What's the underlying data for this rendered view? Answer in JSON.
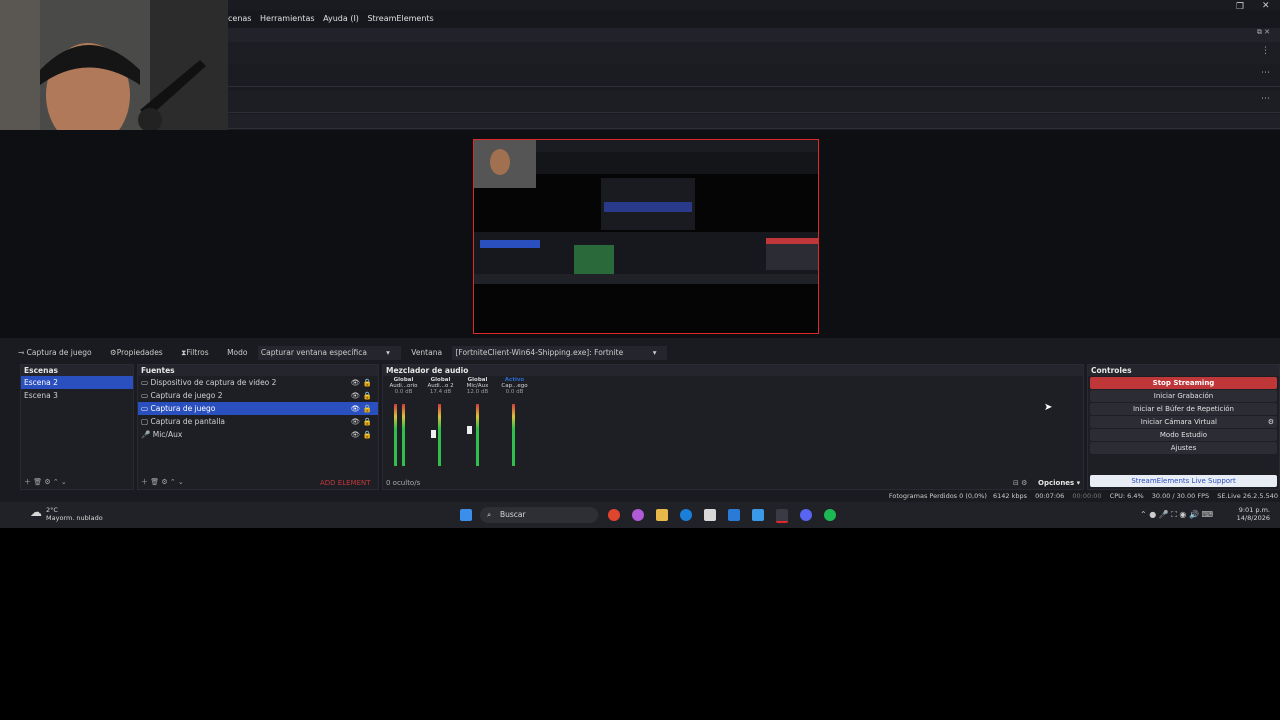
{
  "menubar": {
    "items": [
      "cenas",
      "Herramientas",
      "Ayuda (I)",
      "StreamElements"
    ]
  },
  "toolbar": {
    "source": "Captura de juego",
    "properties": "Propiedades",
    "filters": "Filtros",
    "mode_label": "Modo",
    "mode_value": "Capturar ventana específica",
    "window_label": "Ventana",
    "window_value": "[FortniteClient-Win64-Shipping.exe]: Fortnite"
  },
  "scenes": {
    "title": "Escenas",
    "items": [
      "Escena 2",
      "Escena 3"
    ],
    "selected": 0
  },
  "sources": {
    "title": "Fuentes",
    "items": [
      "Dispositivo de captura de video 2",
      "Captura de juego 2",
      "Captura de juego",
      "Captura de pantalla",
      "Mic/Aux"
    ],
    "selected": 2,
    "add_element": "ADD ELEMENT"
  },
  "mixer": {
    "title": "Mezclador de audio",
    "channels": [
      {
        "tag": "Global",
        "name": "Audi...orio",
        "db": "0.0 dB"
      },
      {
        "tag": "Global",
        "name": "Audi...o 2",
        "db": "17.4 dB"
      },
      {
        "tag": "Global",
        "name": "Mic/Aux",
        "db": "12.0 dB"
      },
      {
        "tag": "Activo",
        "name": "Cap...ego",
        "db": "0.0 dB"
      }
    ],
    "hidden": "0 oculto/s",
    "options": "Opciones"
  },
  "controls": {
    "title": "Controles",
    "stop_streaming": "Stop Streaming",
    "start_recording": "Iniciar Grabación",
    "replay_buffer": "Iniciar el Búfer de Repetición",
    "virtual_cam": "Iniciar Cámara Virtual",
    "studio_mode": "Modo Estudio",
    "settings": "Ajustes",
    "support": "StreamElements Live Support"
  },
  "status": {
    "dropped": "Fotogramas Perdidos 0 (0,0%)",
    "kbps": "6142 kbps",
    "stream_time": "00:07:06",
    "rec_time": "00:00:00",
    "cpu": "CPU: 6.4%",
    "fps": "30.00 / 30.00 FPS",
    "version": "SE.Live 26.2.5.540"
  },
  "taskbar": {
    "weather_temp": "2°C",
    "weather_desc": "Mayorm. nublado",
    "search": "Buscar",
    "time": "9:01 p.m.",
    "date": "14/8/2026"
  },
  "colors": {
    "accent": "#2a4fbf",
    "stop": "#c0373a",
    "preview_border": "#e02828"
  }
}
